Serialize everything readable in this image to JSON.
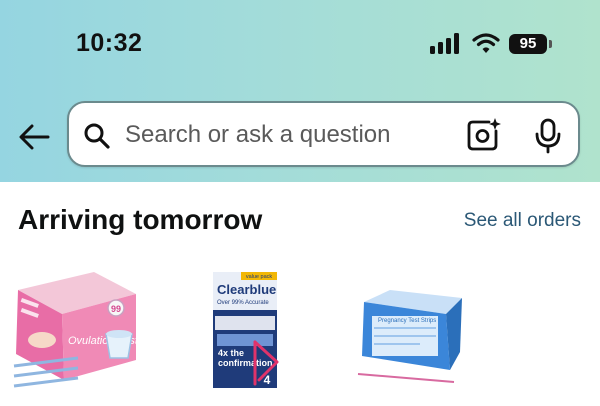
{
  "status_bar": {
    "time": "10:32",
    "battery": "95",
    "icons": [
      "cellular-signal-icon",
      "wifi-icon",
      "battery-icon"
    ]
  },
  "header": {
    "back_icon": "back-arrow-icon",
    "search": {
      "placeholder": "Search or ask a question",
      "icons": [
        "search-icon",
        "camera-lens-icon",
        "microphone-icon"
      ]
    }
  },
  "orders": {
    "title": "Arriving tomorrow",
    "see_all_label": "See all orders",
    "products": [
      {
        "name": "ovulation-test-kit",
        "box_text": "Ovulation Test",
        "badge": "99"
      },
      {
        "name": "clearblue-pregnancy-test",
        "brand": "Clearblue",
        "tag": "value pack",
        "line1": "Over 99% Accurate",
        "line2": "4x the",
        "line3": "confirmation",
        "count": "4"
      },
      {
        "name": "pregnancy-test-strips-box",
        "box_text": "Pregnancy Test Strips"
      }
    ]
  },
  "colors": {
    "header_gradient_start": "#95d5e1",
    "header_gradient_end": "#b0e3cd",
    "link": "#2b5876",
    "title": "#0f1111"
  }
}
